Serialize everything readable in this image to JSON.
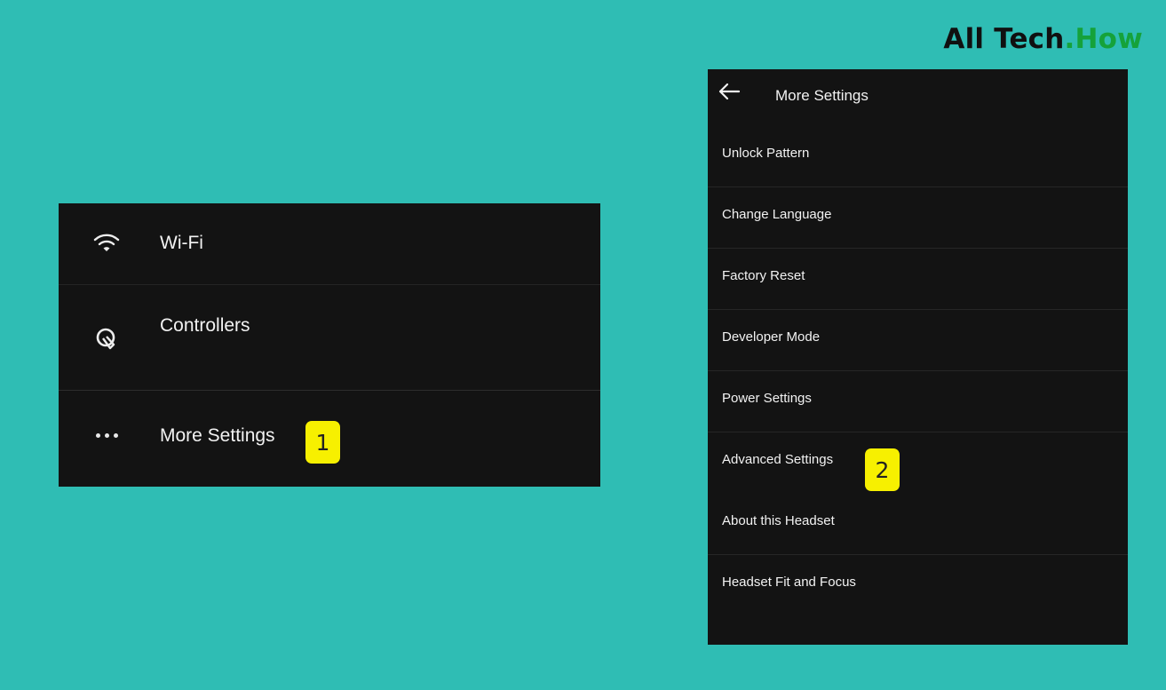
{
  "brand": {
    "part1": "All Tech",
    "part2": ".How",
    "accent_color": "#15a23a"
  },
  "left_panel": {
    "items": [
      {
        "label": "Wi-Fi",
        "icon": "wifi-icon"
      },
      {
        "label": "Controllers",
        "icon": "controller-icon"
      },
      {
        "label": "More Settings",
        "icon": "more-dots-icon"
      }
    ]
  },
  "badges": {
    "step1": "1",
    "step2": "2",
    "color": "#f7f000"
  },
  "right_panel": {
    "back_icon": "back-arrow-icon",
    "title": "More Settings",
    "items": [
      {
        "label": "Unlock Pattern"
      },
      {
        "label": "Change Language"
      },
      {
        "label": "Factory Reset"
      },
      {
        "label": "Developer Mode"
      },
      {
        "label": "Power Settings"
      },
      {
        "label": "Advanced Settings"
      },
      {
        "label": "About this Headset"
      },
      {
        "label": "Headset Fit and Focus"
      }
    ]
  },
  "colors": {
    "background": "#2fbdb4",
    "panel": "#131313",
    "text": "#f2f2f2"
  }
}
